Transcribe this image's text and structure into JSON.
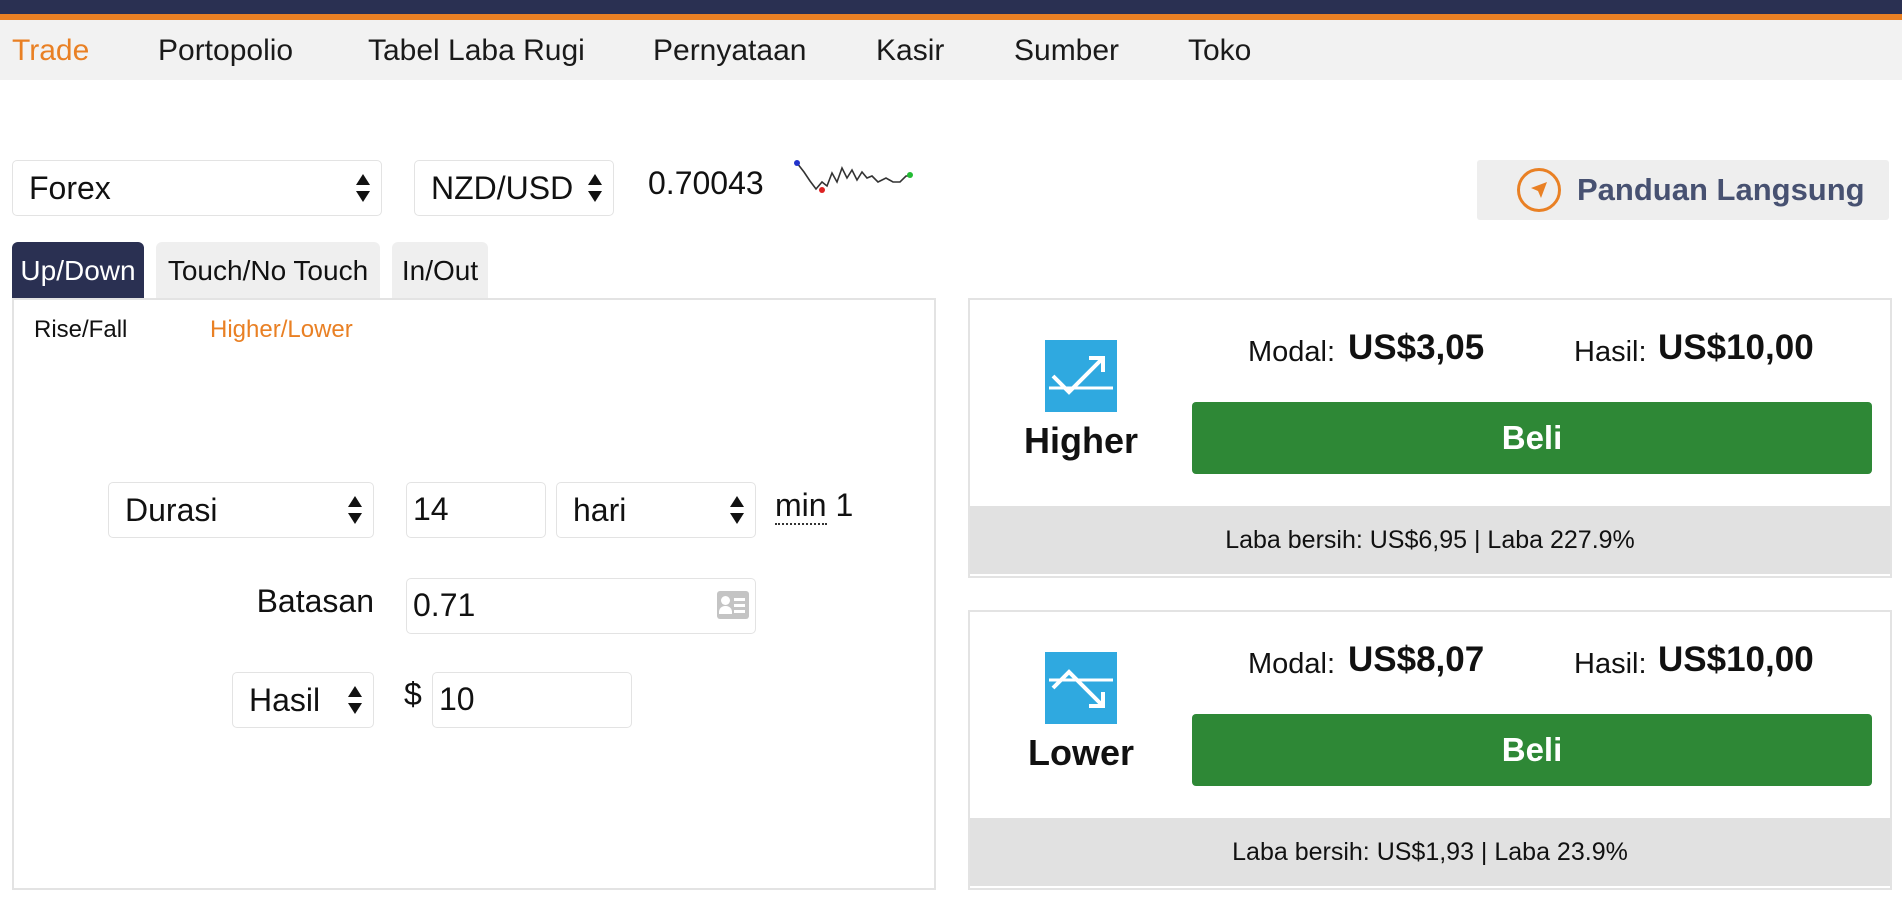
{
  "colors": {
    "brand_dark": "#2a3052",
    "accent": "#e98024",
    "buy_green": "#2e8836",
    "contract_icon_blue": "#2fa9e0",
    "guide_text": "#475171"
  },
  "nav": {
    "items": [
      {
        "label": "Trade",
        "active": true
      },
      {
        "label": "Portopolio"
      },
      {
        "label": "Tabel Laba Rugi"
      },
      {
        "label": "Pernyataan"
      },
      {
        "label": "Kasir"
      },
      {
        "label": "Sumber"
      },
      {
        "label": "Toko"
      }
    ]
  },
  "market": {
    "market_select": "Forex",
    "symbol_select": "NZD/USD",
    "spot": "0.70043",
    "sparkline_icon": "price-sparkline"
  },
  "guide": {
    "label": "Panduan Langsung",
    "icon": "navigation-arrow-icon"
  },
  "tabs": [
    {
      "label": "Up/Down",
      "active": true
    },
    {
      "label": "Touch/No Touch"
    },
    {
      "label": "In/Out"
    }
  ],
  "subtabs": [
    {
      "label": "Rise/Fall"
    },
    {
      "label": "Higher/Lower",
      "active": true
    }
  ],
  "form": {
    "duration_type": "Durasi",
    "duration_value": "14",
    "duration_unit": "hari",
    "min_label": "min",
    "min_value": "1",
    "barrier_label": "Batasan",
    "barrier_value": "0.71",
    "barrier_icon": "contact-card-icon",
    "amount_type": "Hasil",
    "currency_symbol": "$",
    "amount_value": "10"
  },
  "contracts": [
    {
      "name": "Higher",
      "icon": "trend-up-icon",
      "stake_label": "Modal:",
      "stake_value": "US$3,05",
      "payout_label": "Hasil:",
      "payout_value": "US$10,00",
      "buy_label": "Beli",
      "footer": "Laba bersih: US$6,95 | Laba 227.9%"
    },
    {
      "name": "Lower",
      "icon": "trend-down-icon",
      "stake_label": "Modal:",
      "stake_value": "US$8,07",
      "payout_label": "Hasil:",
      "payout_value": "US$10,00",
      "buy_label": "Beli",
      "footer": "Laba bersih: US$1,93 | Laba 23.9%"
    }
  ]
}
